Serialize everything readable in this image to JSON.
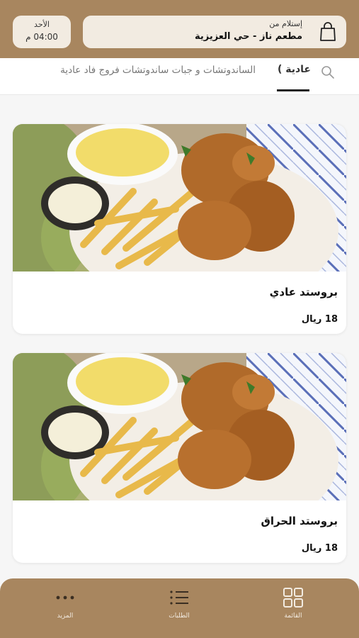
{
  "header": {
    "pickup_label": "إستلام من",
    "restaurant": "مطعم ناز - حي العزيزية",
    "day": "الأحد",
    "time": "04:00 م"
  },
  "tabs": {
    "active": "عادية )",
    "other": "الساندوتشات و جبات ساندوتشات فروج فاد عادية"
  },
  "products": [
    {
      "name": "بروستد عادي",
      "price": "18 ريال"
    },
    {
      "name": "بروستد الحراق",
      "price": "18 ريال"
    }
  ],
  "bottom_nav": {
    "menu": "القائمة",
    "orders": "الطلبات",
    "more": "المزيد"
  },
  "colors": {
    "brand": "#a8865f",
    "header_pill": "#f2ebe1"
  },
  "icons": [
    "bag-icon",
    "search-icon",
    "grid-icon",
    "list-icon",
    "more-icon"
  ]
}
